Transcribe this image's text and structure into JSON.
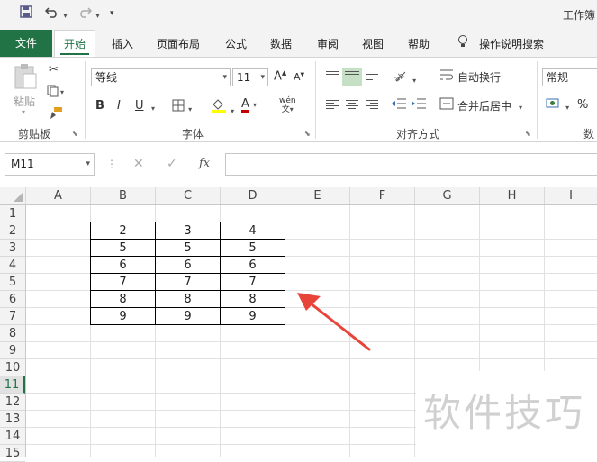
{
  "window": {
    "title": "工作簿"
  },
  "quick_access": {
    "save_icon": "save-icon",
    "undo_icon": "undo-icon",
    "redo_icon": "redo-icon",
    "customize_icon": "customize-arrow-icon"
  },
  "tabs": {
    "file": "文件",
    "items": [
      "开始",
      "插入",
      "页面布局",
      "公式",
      "数据",
      "审阅",
      "视图",
      "帮助"
    ],
    "tell_me": "操作说明搜索"
  },
  "ribbon": {
    "clipboard": {
      "paste": "粘贴",
      "label": "剪贴板"
    },
    "font": {
      "name": "等线",
      "size": "11",
      "bold": "B",
      "italic": "I",
      "underline": "U",
      "font_color_letter": "A",
      "phonetic": "wén",
      "label": "字体",
      "grow": "A",
      "shrink": "A"
    },
    "alignment": {
      "wrap": "自动换行",
      "merge": "合并后居中",
      "label": "对齐方式"
    },
    "number": {
      "format": "常规",
      "percent": "%",
      "label": "数字"
    }
  },
  "formula_bar": {
    "name_box": "M11",
    "fx": "fx",
    "formula": ""
  },
  "sheet": {
    "columns": [
      "A",
      "B",
      "C",
      "D",
      "E",
      "F",
      "G",
      "H",
      "I"
    ],
    "rows": [
      "1",
      "2",
      "3",
      "4",
      "5",
      "6",
      "7",
      "8",
      "9",
      "10",
      "11",
      "12",
      "13",
      "14",
      "15"
    ],
    "active_row": "11",
    "table": [
      [
        "2",
        "3",
        "4"
      ],
      [
        "5",
        "5",
        "5"
      ],
      [
        "6",
        "6",
        "6"
      ],
      [
        "7",
        "7",
        "7"
      ],
      [
        "8",
        "8",
        "8"
      ],
      [
        "9",
        "9",
        "9"
      ]
    ]
  },
  "annotation": {
    "arrow_color": "#e8443a"
  },
  "watermark": "软件技巧",
  "colors": {
    "accent": "#217346"
  }
}
